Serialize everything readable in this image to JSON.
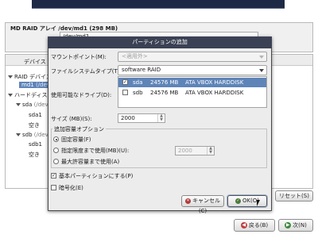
{
  "background": {
    "raid_title": "MD RAID アレイ /dev/md1 (298 MB)",
    "raid_path": "/dev/md1",
    "tree_header": "デバイス",
    "tree": [
      {
        "label": "RAID デバイス"
      },
      {
        "label": "md1",
        "sub": "(/dev/md1)"
      },
      {
        "label": "ハードディスク"
      },
      {
        "label": "sda",
        "sub": "(/dev/sda)"
      },
      {
        "label": "sda1"
      },
      {
        "label": "空き"
      },
      {
        "label": "sdb",
        "sub": "(/dev/sdb)"
      },
      {
        "label": "sdb1"
      },
      {
        "label": "空き"
      }
    ],
    "reset_label": "リセット(S)",
    "back_label": "戻る(B)",
    "next_label": "次(N)"
  },
  "dialog": {
    "title": "パーティションの追加",
    "mount_label": "マウントポイント(M):",
    "mount_value": "<適用外>",
    "fs_label": "ファイルシステムタイプ(T):",
    "fs_value": "software RAID",
    "drives_label": "使用可能なドライブ(D):",
    "drives": [
      {
        "checked": true,
        "name": "sda",
        "size": "24576 MB",
        "model": "ATA VBOX HARDDISK",
        "selected": true
      },
      {
        "checked": false,
        "name": "sdb",
        "size": "24576 MB",
        "model": "ATA VBOX HARDDISK",
        "selected": false
      }
    ],
    "size_label": "サイズ (MB)(S):",
    "size_value": "2000",
    "options_title": "追加容量オプション",
    "opt_fixed": "固定容量(F)",
    "opt_upto": "指定限度まで使用(MB)(U):",
    "opt_upto_value": "2000",
    "opt_max": "最大許容量まで使用(A)",
    "primary_label": "基本パーティションにする(P)",
    "encrypt_label": "暗号化(E)",
    "cancel_label": "キャンセル(C)",
    "ok_label": "OK(O)"
  },
  "colors": {
    "titlebar": "#3b4154",
    "selection": "#5e84b8"
  }
}
